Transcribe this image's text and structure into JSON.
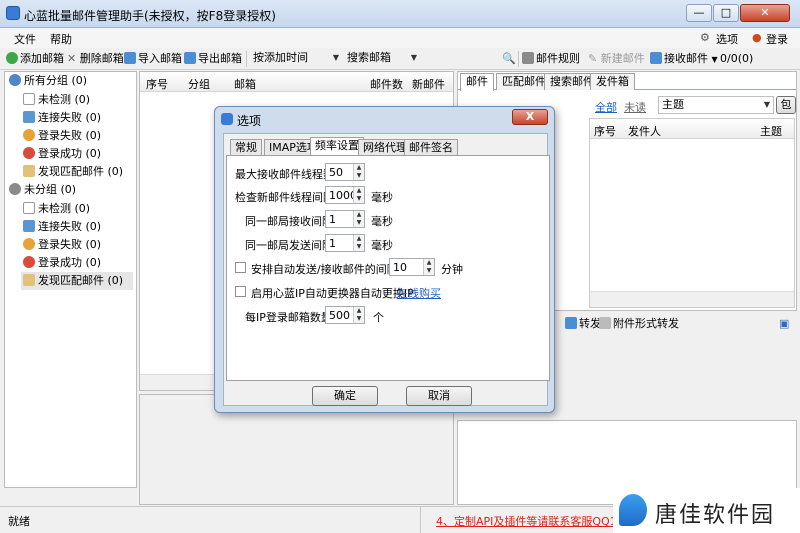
{
  "window": {
    "title": "心蓝批量邮件管理助手(未授权，按F8登录授权)",
    "minimize": "—",
    "maximize": "□",
    "close": "✕"
  },
  "menu": {
    "file": "文件",
    "help": "帮助",
    "options": "选项",
    "login": "登录"
  },
  "toolbar": {
    "add": "添加邮箱",
    "delete": "删除邮箱",
    "import": "导入邮箱",
    "export": "导出邮箱",
    "sort": "按添加时间",
    "search": "搜索邮箱",
    "rules": "邮件规则",
    "new_mail": "新建邮件",
    "receive": "接收邮件",
    "counter": "0/0(0)"
  },
  "tree": {
    "all_group": "所有分组",
    "all_count": "(0)",
    "ungrouped": "未分组",
    "ungrouped_count": "(0)",
    "items": [
      {
        "label": "未检测",
        "count": "(0)"
      },
      {
        "label": "连接失败",
        "count": "(0)"
      },
      {
        "label": "登录失败",
        "count": "(0)"
      },
      {
        "label": "登录成功",
        "count": "(0)"
      },
      {
        "label": "发现匹配邮件",
        "count": "(0)"
      }
    ]
  },
  "grid": {
    "col_seq": "序号",
    "col_group": "分组",
    "col_mailbox": "邮箱",
    "col_count": "邮件数",
    "col_new": "新邮件"
  },
  "right": {
    "tabs": [
      "邮件",
      "匹配邮件",
      "搜索邮件",
      "发件箱"
    ],
    "filter_all": "全部",
    "filter_unread": "未读",
    "subject_combo": "主题",
    "include_btn": "包",
    "col_seq": "序号",
    "col_sender": "发件人",
    "col_subject": "主题",
    "forward": "转发",
    "attach_forward": "附件形式转发"
  },
  "status": {
    "ready": "就绪",
    "ad": "4、定制API及插件等请联系客服QQ1183"
  },
  "watermark": "唐佳软件园",
  "dialog": {
    "title": "选项",
    "close": "X",
    "tabs": [
      "常规",
      "IMAP选项",
      "频率设置",
      "网络代理",
      "邮件签名"
    ],
    "fields": {
      "max_threads_label": "最大接收邮件线程数",
      "max_threads": "50",
      "check_interval_label": "检查新邮件线程间隔",
      "check_interval": "1000",
      "unit_ms": "毫秒",
      "same_recv_label": "同一邮局接收间隔",
      "same_recv": "1",
      "same_send_label": "同一邮局发送间隔",
      "same_send": "1",
      "auto_schedule_label": "安排自动发送/接收邮件的间隔为",
      "auto_schedule": "10",
      "unit_min": "分钟",
      "ip_switch_label": "启用心蓝IP自动更换器自动更换IP",
      "buy_online": "在线购买",
      "per_ip_label": "每IP登录邮箱数量",
      "per_ip": "500",
      "unit_count": "个"
    },
    "ok": "确定",
    "cancel": "取消"
  }
}
